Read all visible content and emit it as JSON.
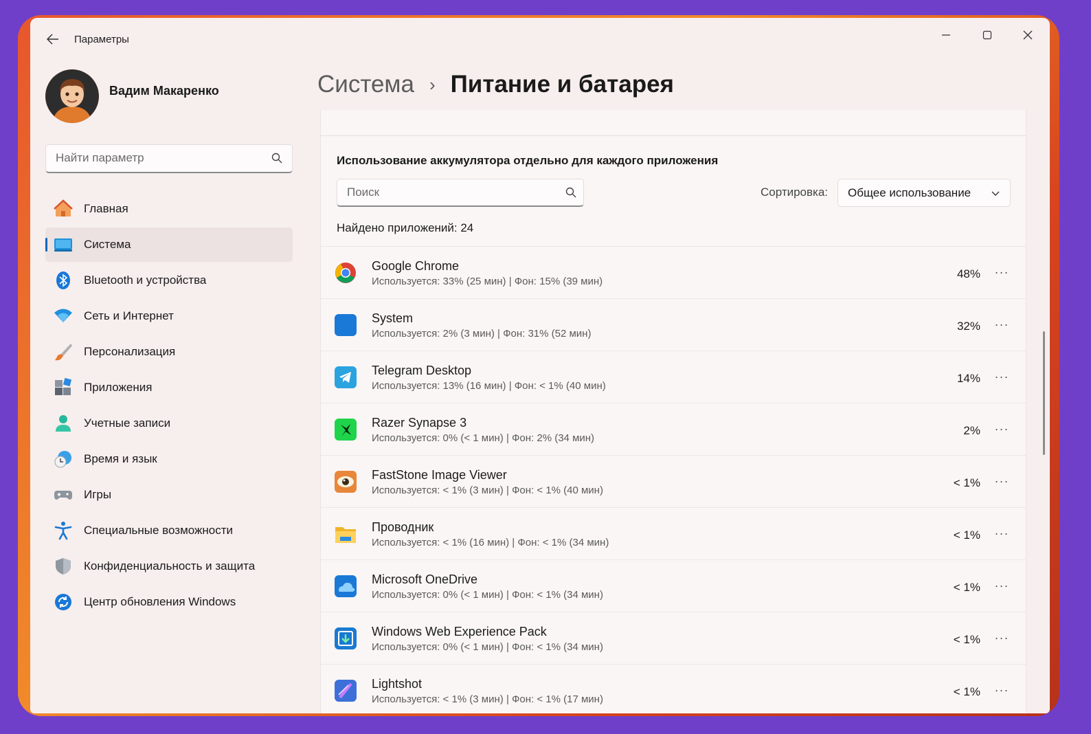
{
  "window": {
    "title": "Параметры",
    "controls": [
      "minimize-icon",
      "maximize-icon",
      "close-icon"
    ]
  },
  "user": {
    "name": "Вадим Макаренко"
  },
  "search": {
    "placeholder": "Найти параметр"
  },
  "sidebar": {
    "items": [
      {
        "label": "Главная",
        "icon": "home-icon",
        "active": false
      },
      {
        "label": "Система",
        "icon": "system-icon",
        "active": true
      },
      {
        "label": "Bluetooth и устройства",
        "icon": "bluetooth-icon",
        "active": false
      },
      {
        "label": "Сеть и Интернет",
        "icon": "wifi-icon",
        "active": false
      },
      {
        "label": "Персонализация",
        "icon": "brush-icon",
        "active": false
      },
      {
        "label": "Приложения",
        "icon": "apps-icon",
        "active": false
      },
      {
        "label": "Учетные записи",
        "icon": "account-icon",
        "active": false
      },
      {
        "label": "Время и язык",
        "icon": "clock-icon",
        "active": false
      },
      {
        "label": "Игры",
        "icon": "gamepad-icon",
        "active": false
      },
      {
        "label": "Специальные возможности",
        "icon": "accessibility-icon",
        "active": false
      },
      {
        "label": "Конфиденциальность и защита",
        "icon": "shield-icon",
        "active": false
      },
      {
        "label": "Центр обновления Windows",
        "icon": "update-icon",
        "active": false
      }
    ]
  },
  "breadcrumb": {
    "parent": "Система",
    "separator": "›",
    "current": "Питание и батарея"
  },
  "battery_usage": {
    "title": "Использование аккумулятора отдельно для каждого приложения",
    "search_placeholder": "Поиск",
    "sort_label": "Сортировка:",
    "sort_value": "Общее использование",
    "found_text": "Найдено приложений: 24",
    "apps": [
      {
        "name": "Google Chrome",
        "detail": "Используется: 33% (25 мин) | Фон: 15% (39 мин)",
        "percent": "48%",
        "icon": "chrome-icon"
      },
      {
        "name": "System",
        "detail": "Используется: 2% (3 мин) | Фон: 31% (52 мин)",
        "percent": "32%",
        "icon": "system-app-icon"
      },
      {
        "name": "Telegram Desktop",
        "detail": "Используется: 13% (16 мин) | Фон: < 1% (40 мин)",
        "percent": "14%",
        "icon": "telegram-icon"
      },
      {
        "name": "Razer Synapse 3",
        "detail": "Используется: 0% (< 1 мин) | Фон: 2% (34 мин)",
        "percent": "2%",
        "icon": "razer-icon"
      },
      {
        "name": "FastStone Image Viewer",
        "detail": "Используется: < 1% (3 мин) | Фон: < 1% (40 мин)",
        "percent": "< 1%",
        "icon": "faststone-icon"
      },
      {
        "name": "Проводник",
        "detail": "Используется: < 1% (16 мин) | Фон: < 1% (34 мин)",
        "percent": "< 1%",
        "icon": "explorer-icon"
      },
      {
        "name": "Microsoft OneDrive",
        "detail": "Используется: 0% (< 1 мин) | Фон: < 1% (34 мин)",
        "percent": "< 1%",
        "icon": "onedrive-icon"
      },
      {
        "name": "Windows Web Experience Pack",
        "detail": "Используется: 0% (< 1 мин) | Фон: < 1% (34 мин)",
        "percent": "< 1%",
        "icon": "web-experience-icon"
      },
      {
        "name": "Lightshot",
        "detail": "Используется: < 1% (3 мин) | Фон: < 1% (17 мин)",
        "percent": "< 1%",
        "icon": "lightshot-icon"
      }
    ]
  },
  "colors": {
    "accent": "#0067c0",
    "window_bg": "#f7eeee",
    "panel_bg": "#fbf6f6",
    "page_bg": "#6f3fc9"
  }
}
